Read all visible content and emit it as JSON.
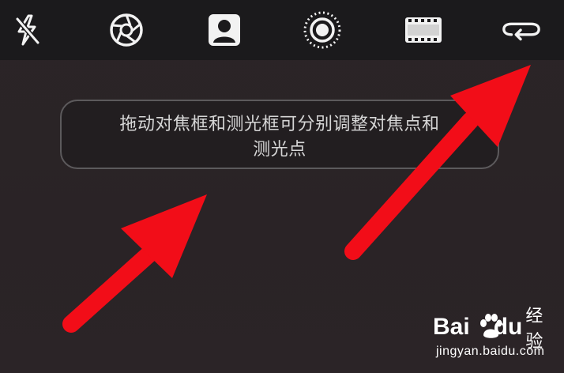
{
  "toolbar": {
    "items": [
      {
        "icon": "flash-off-icon"
      },
      {
        "icon": "aperture-icon"
      },
      {
        "icon": "portrait-icon"
      },
      {
        "icon": "live-photo-icon"
      },
      {
        "icon": "film-icon"
      },
      {
        "icon": "loop-icon"
      }
    ]
  },
  "toast": {
    "line1": "拖动对焦框和测光框可分别调整对焦点和",
    "line2": "测光点"
  },
  "annotation": {
    "arrow_color": "#f20d18"
  },
  "watermark": {
    "brand_bai": "Bai",
    "brand_du": "du",
    "brand_suffix": "经验",
    "url": "jingyan.baidu.com"
  },
  "colors": {
    "background": "#2a2426",
    "toolbar": "#1b1a1c",
    "icon": "#f2f2f2",
    "toast_text": "#d6d6d6"
  }
}
